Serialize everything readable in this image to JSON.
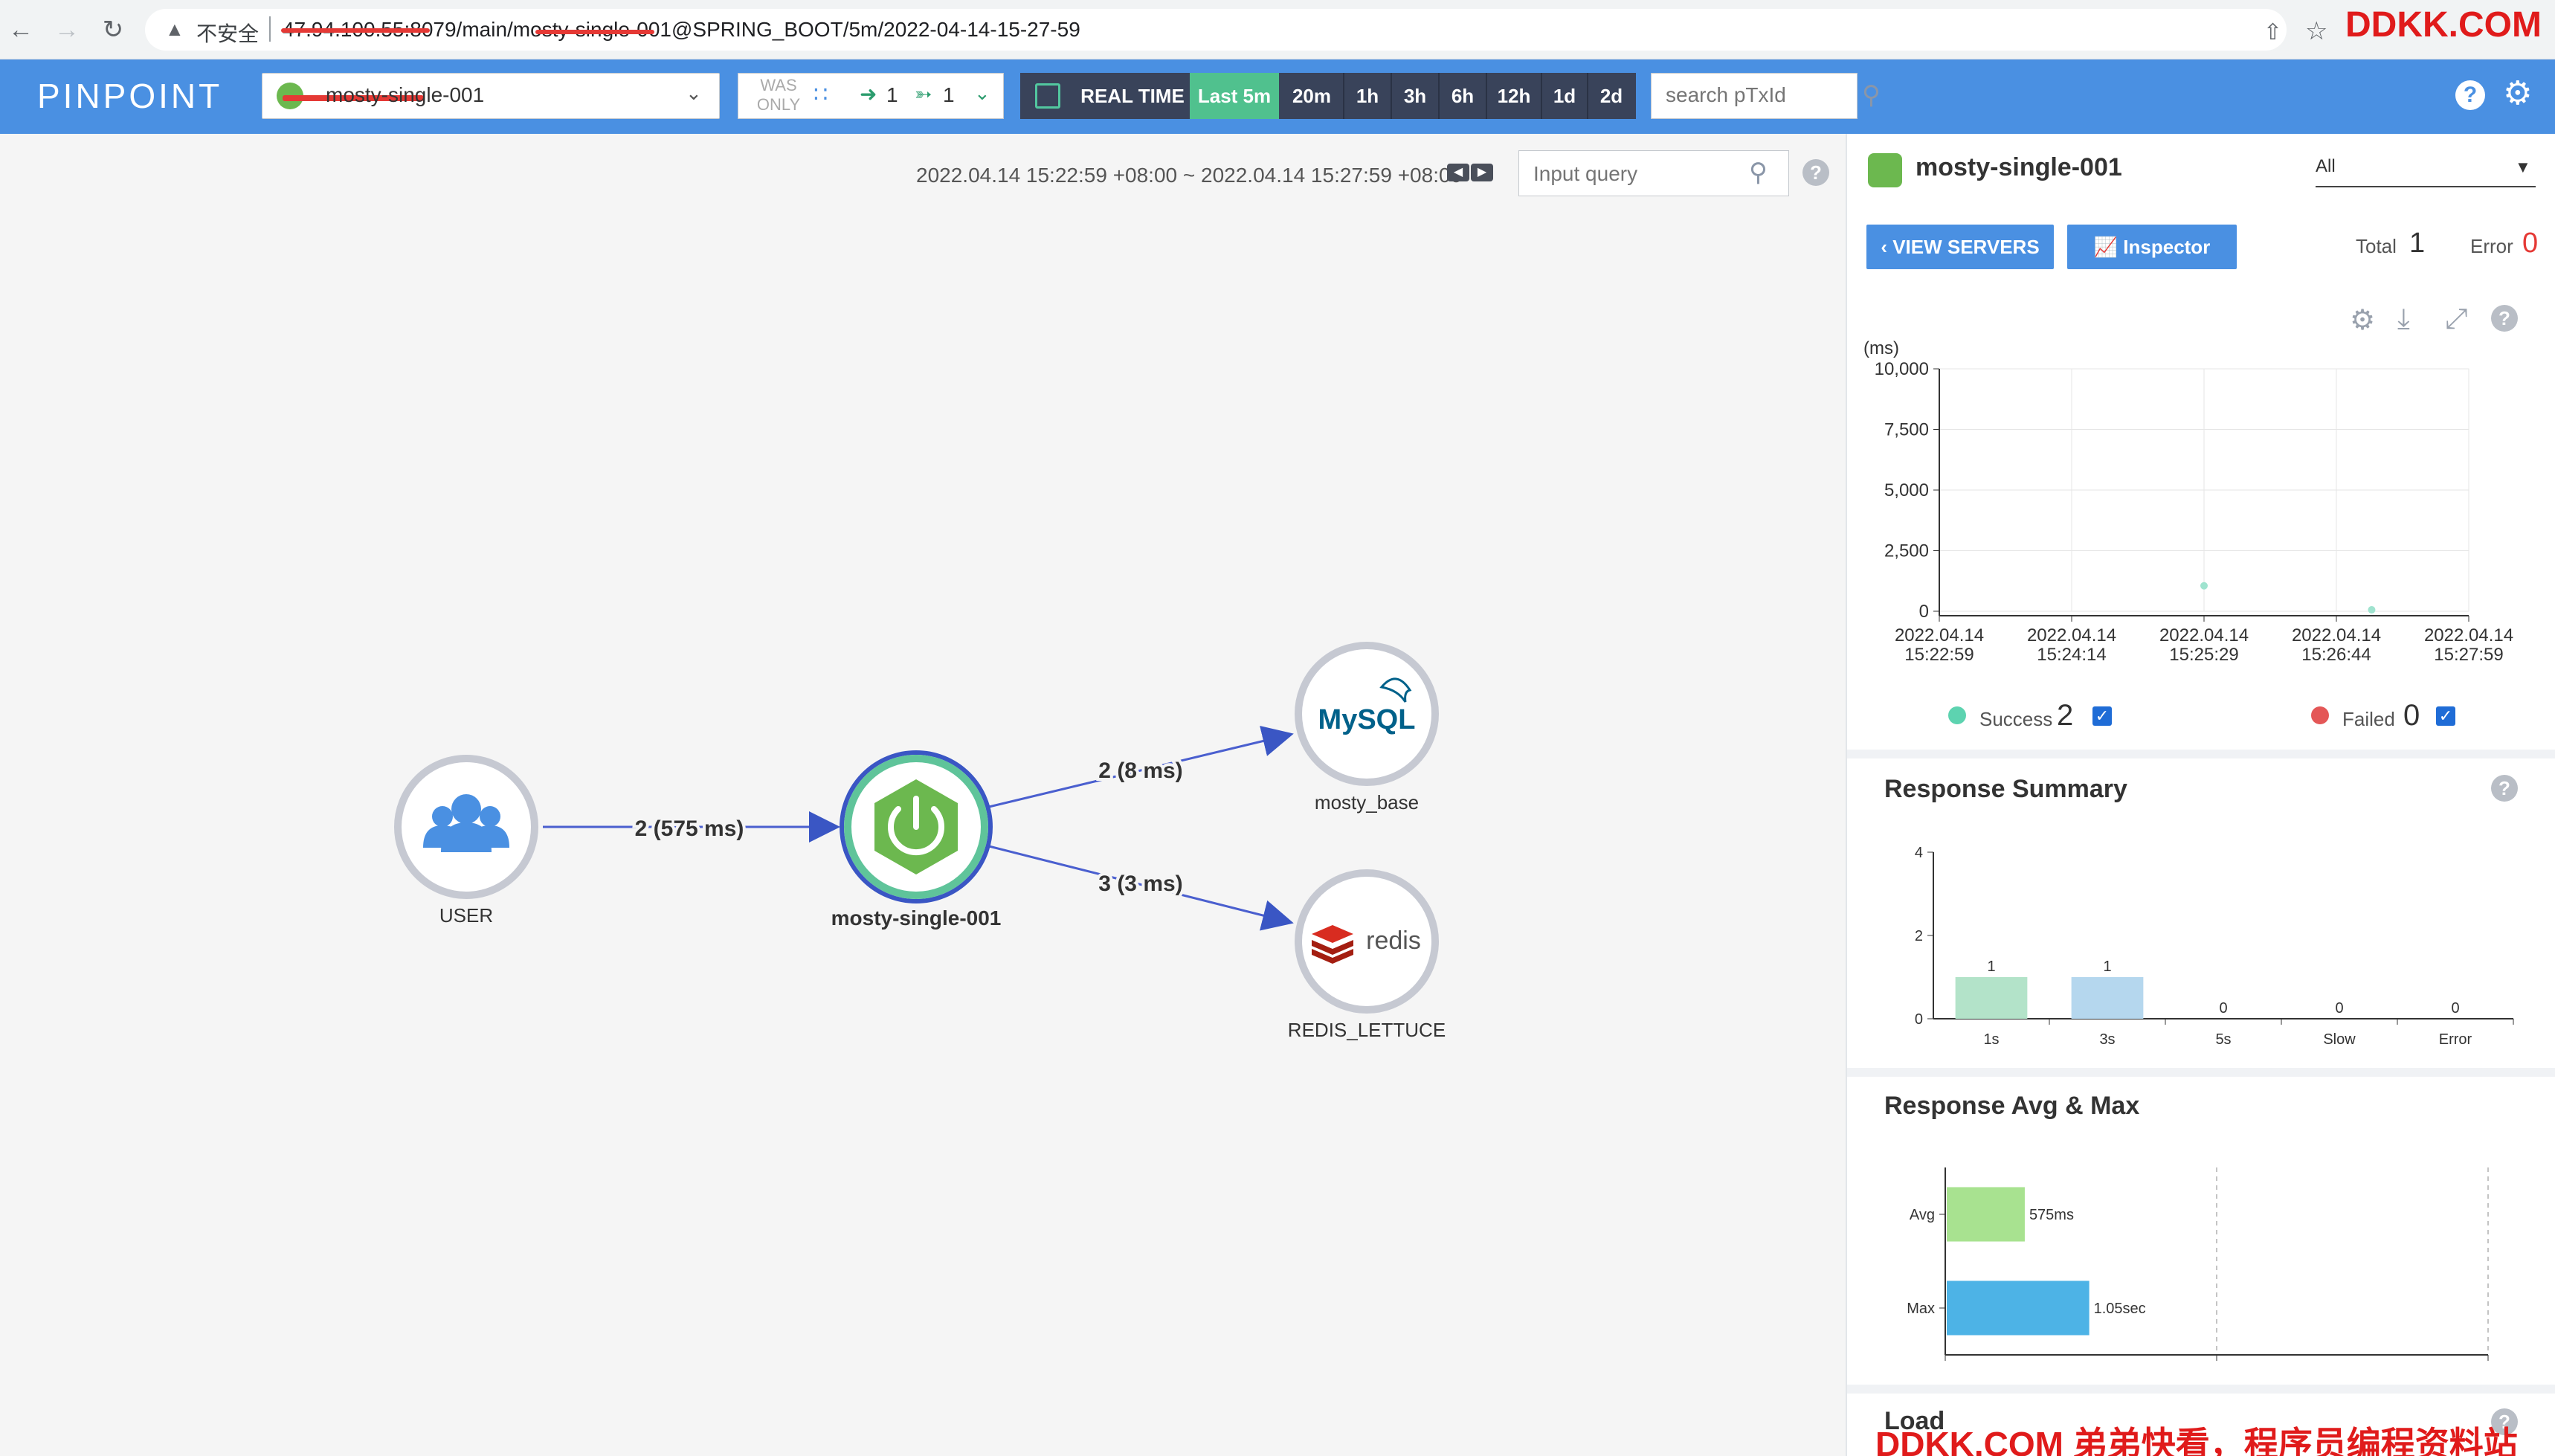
{
  "browser": {
    "insecure_label": "不安全",
    "url": "47.94.100.55:8079/main/mosty-single-001@SPRING_BOOT/5m/2022-04-14-15-27-59",
    "watermark": "DDKK.COM"
  },
  "header": {
    "logo": "PINPOINT",
    "app_selected": "mosty-single-001",
    "was_only": "WAS ONLY",
    "inbound": "1",
    "outbound": "1",
    "time_options": [
      "REAL TIME",
      "Last 5m",
      "20m",
      "1h",
      "3h",
      "6h",
      "12h",
      "1d",
      "2d"
    ],
    "time_active": "Last 5m",
    "search_placeholder": "search pTxId"
  },
  "map": {
    "range": "2022.04.14 15:22:59 +08:00 ~ 2022.04.14 15:27:59 +08:00",
    "query_placeholder": "Input query",
    "nodes": {
      "user": "USER",
      "app": "mosty-single-001",
      "mysql": "mosty_base",
      "mysql_logo": "MySQL",
      "redis": "REDIS_LETTUCE",
      "redis_logo": "redis"
    },
    "links": {
      "user_app": "2 (575 ms)",
      "app_mysql": "2 (8 ms)",
      "app_redis": "3 (3 ms)"
    }
  },
  "panel": {
    "app_name": "mosty-single-001",
    "agent_select": "All",
    "view_servers": "VIEW SERVERS",
    "inspector": "Inspector",
    "total_label": "Total",
    "total_value": "1",
    "error_label": "Error",
    "error_value": "0",
    "legend": {
      "success_label": "Success",
      "success_value": "2",
      "failed_label": "Failed",
      "failed_value": "0"
    },
    "response_summary_title": "Response Summary",
    "response_avgmax_title": "Response Avg & Max",
    "load_title": "Load"
  },
  "chart_data": [
    {
      "type": "scatter",
      "title": "",
      "ylabel": "(ms)",
      "y_ticks": [
        "10,000",
        "7,500",
        "5,000",
        "2,500",
        "0"
      ],
      "ylim": [
        0,
        10000
      ],
      "x_ticks": [
        [
          "2022.04.14",
          "15:22:59"
        ],
        [
          "2022.04.14",
          "15:24:14"
        ],
        [
          "2022.04.14",
          "15:25:29"
        ],
        [
          "2022.04.14",
          "15:26:44"
        ],
        [
          "2022.04.14",
          "15:27:59"
        ]
      ],
      "series": [
        {
          "name": "Success",
          "points": [
            {
              "x": "2022.04.14 15:25:29",
              "y": 1050
            },
            {
              "x": "2022.04.14 15:27:04",
              "y": 60
            }
          ]
        },
        {
          "name": "Failed",
          "points": []
        }
      ],
      "grid": true
    },
    {
      "type": "bar",
      "title": "Response Summary",
      "categories": [
        "1s",
        "3s",
        "5s",
        "Slow",
        "Error"
      ],
      "values": [
        1,
        1,
        0,
        0,
        0
      ],
      "y_ticks": [
        "4",
        "2",
        "0"
      ],
      "ylim": [
        0,
        4
      ],
      "colors": [
        "#b3e3c9",
        "#b5d7ee",
        "#e8c27a",
        "#f5a623",
        "#e45757"
      ]
    },
    {
      "type": "bar",
      "orientation": "horizontal",
      "title": "Response Avg & Max",
      "categories": [
        "Avg",
        "Max"
      ],
      "values": [
        575,
        1050
      ],
      "value_labels": [
        "575ms",
        "1.05sec"
      ],
      "x_ticks": [
        "0ms",
        "2sec",
        "4sec"
      ],
      "xlim": [
        0,
        4000
      ],
      "colors": [
        "#a8e290",
        "#4db3e6"
      ]
    }
  ]
}
